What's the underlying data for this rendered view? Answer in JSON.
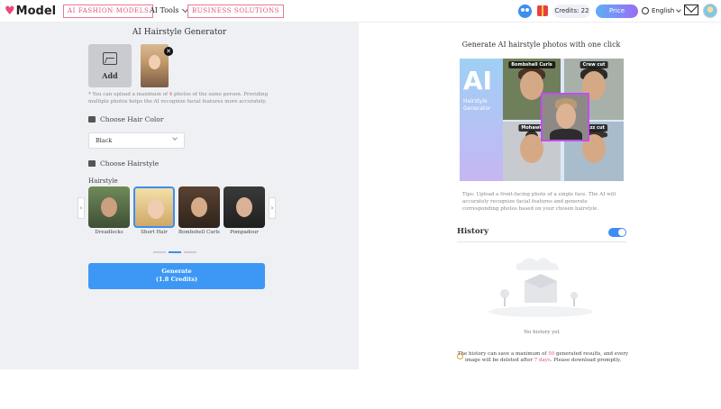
{
  "header": {
    "logo_text": "Model",
    "nav_fashion": "AI FASHION MODELS",
    "nav_tools": "AI Tools",
    "nav_business": "BUSINESS SOLUTIONS",
    "credits": "Credits: 22",
    "price": "Price",
    "language": "English"
  },
  "left": {
    "title": "AI Hairstyle Generator",
    "add_label": "Add",
    "note_prefix": "* You can upload a maximum of ",
    "note_count": "4",
    "note_suffix": " photos of the same person. Providing multiple photos helps the AI recognize facial features more accurately.",
    "hair_color_label": "Choose Hair Color",
    "hair_color_value": "Black",
    "hairstyle_label": "Choose Hairstyle",
    "hairstyle_sublabel": "Hairstyle",
    "styles": [
      {
        "label": "Dreadlocks"
      },
      {
        "label": "Short Hair"
      },
      {
        "label": "Bombshell Curls"
      },
      {
        "label": "Pompadour"
      }
    ],
    "generate_label": "Generate",
    "generate_credits": "(1.8 Credits)"
  },
  "right": {
    "title": "Generate AI hairstyle photos with one click",
    "collage": {
      "ai_text": "AI",
      "ai_sub1": "Hairstyle",
      "ai_sub2": "Generator",
      "tag_bombshell": "Bombshell Curls",
      "tag_crew": "Crew cut",
      "tag_mohawk": "Mohawk",
      "tag_buzz": "Buzz cut"
    },
    "tips": "Tips: Upload a front-facing photo of a single face. The AI will accurately recognize facial features and generate corresponding photos based on your chosen hairstyle.",
    "history_title": "History",
    "history_toggle_on": true,
    "no_history": "No history yet",
    "footer_prefix": "The history can save a maximum of ",
    "footer_count": "50",
    "footer_mid": " generated results, and every image will be deleted after ",
    "footer_days": "7 days",
    "footer_suffix": ". Please download promptly."
  },
  "colors": {
    "accent_blue": "#3d8ef0",
    "brand_pink": "#e0557d"
  }
}
